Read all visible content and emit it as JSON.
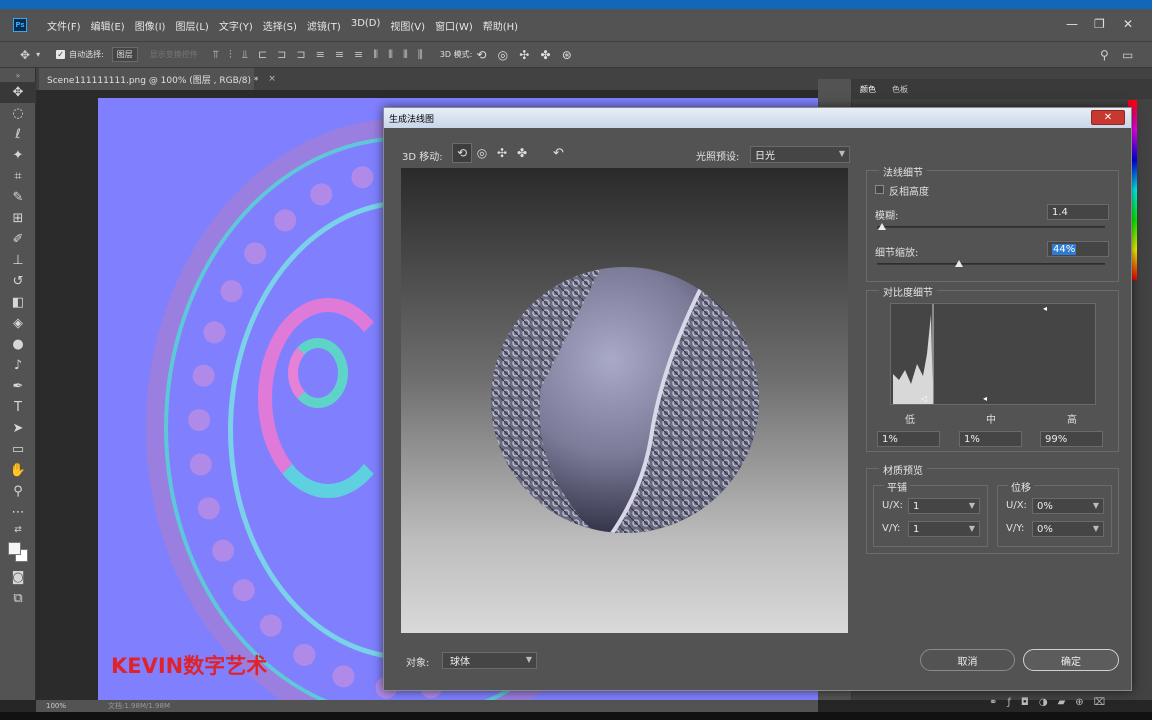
{
  "app": {
    "logo": "Ps",
    "menus": [
      "文件(F)",
      "编辑(E)",
      "图像(I)",
      "图层(L)",
      "文字(Y)",
      "选择(S)",
      "滤镜(T)",
      "3D(D)",
      "视图(V)",
      "窗口(W)",
      "帮助(H)"
    ],
    "window_controls": [
      "—",
      "❐",
      "✕"
    ]
  },
  "options_bar": {
    "auto_select_label": "自动选择:",
    "auto_select_value": "图层",
    "show_transform_label": "显示变换控件",
    "mode_3d_label": "3D 模式:"
  },
  "document": {
    "tab_title": "Scene111111111.png @ 100% (图层 , RGB/8) *",
    "tab_close": "×",
    "zoom": "100%",
    "doc_info": "文档:1.98M/1.98M",
    "watermark": "KEVIN数字艺术"
  },
  "panels": {
    "tabs": [
      "颜色",
      "色板"
    ]
  },
  "dialog": {
    "title": "生成法线图",
    "close": "✕",
    "move_label": "3D 移动:",
    "light_preset_label": "光照预设:",
    "light_preset_value": "日光",
    "object_label": "对象:",
    "object_value": "球体",
    "cancel_label": "取消",
    "ok_label": "确定",
    "normal_detail": {
      "title": "法线细节",
      "invert_height_label": "反相高度",
      "invert_height_checked": false,
      "blur_label": "模糊:",
      "blur_value": "1.4",
      "blur_fraction": 0.02,
      "detail_scale_label": "细节缩放:",
      "detail_scale_value": "44%",
      "detail_scale_fraction": 0.36
    },
    "contrast_detail": {
      "title": "对比度细节",
      "low_label": "低",
      "mid_label": "中",
      "high_label": "高",
      "low_value": "1%",
      "mid_value": "1%",
      "high_value": "99%"
    },
    "material_preview": {
      "title": "材质预览",
      "tiling_title": "平铺",
      "offset_title": "位移",
      "ux_label": "U/X:",
      "vy_label": "V/Y:",
      "tiling_ux": "1",
      "tiling_vy": "1",
      "offset_ux": "0%",
      "offset_vy": "0%"
    }
  }
}
